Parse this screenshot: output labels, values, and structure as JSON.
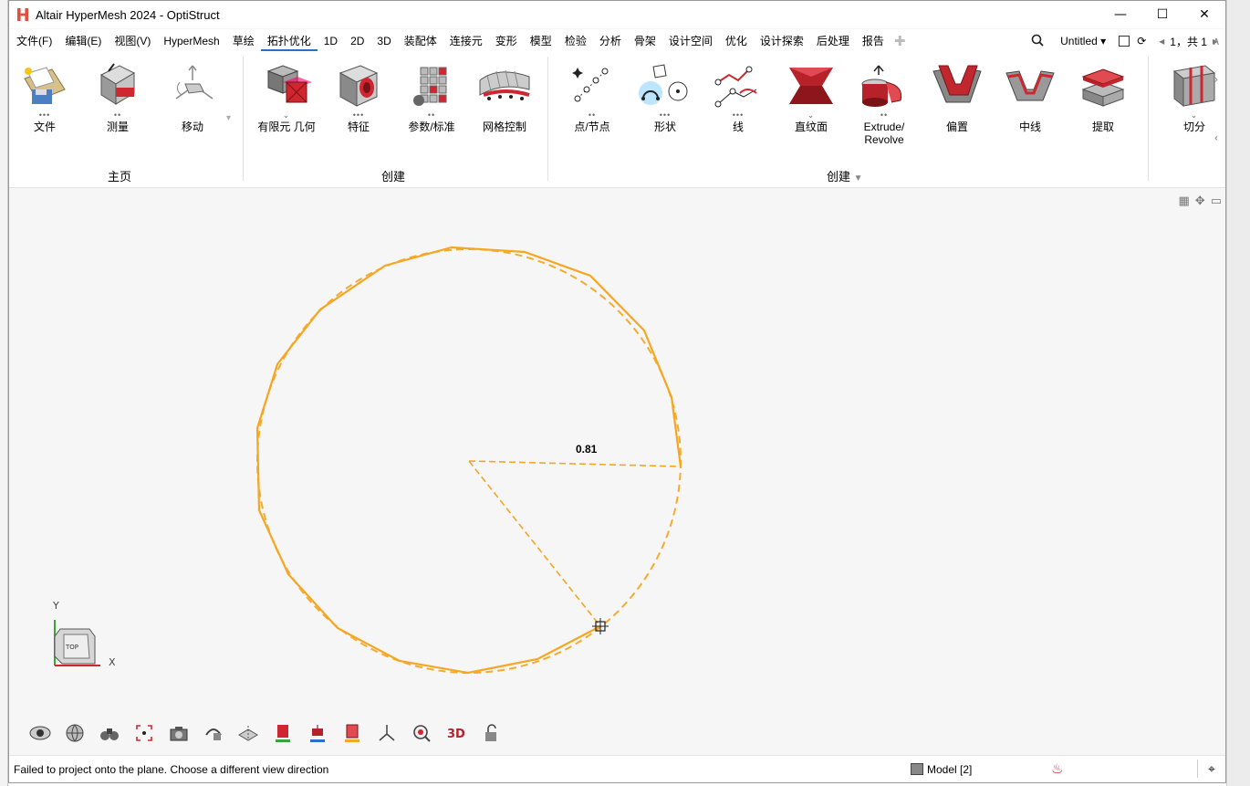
{
  "window": {
    "title": "Altair HyperMesh 2024 - OptiStruct",
    "minimize": "—",
    "maximize": "☐",
    "close": "✕"
  },
  "menu": {
    "items": [
      "文件(F)",
      "编辑(E)",
      "视图(V)",
      "HyperMesh",
      "草绘",
      "拓扑优化",
      "1D",
      "2D",
      "3D",
      "装配体",
      "连接元",
      "变形",
      "模型",
      "检验",
      "分析",
      "骨架",
      "设计空间",
      "优化",
      "设计探索",
      "后处理",
      "报告"
    ],
    "active_index": 5,
    "search_icon": "search-icon",
    "session_name": "Untitled",
    "page_indicator": "1，共 1"
  },
  "ribbon": {
    "home": {
      "group_label": "主页",
      "tools": [
        "文件",
        "测量",
        "移动"
      ]
    },
    "create1": {
      "group_label": "创建",
      "tools": [
        "有限元 几何",
        "特征",
        "参数/标准",
        "网格控制"
      ]
    },
    "create2": {
      "group_label": "创建",
      "tools": [
        "点/节点",
        "形状",
        "线",
        "直纹面",
        "Extrude/\nRevolve",
        "偏置",
        "中线",
        "提取"
      ]
    },
    "cut": {
      "tools": [
        "切分"
      ]
    }
  },
  "viewport": {
    "dimension_label": "0.81",
    "axis_y": "Y",
    "axis_x": "X",
    "viewcube_label": "TOP",
    "accent": "#f5a623"
  },
  "status": {
    "message": "Failed to project onto the plane. Choose a different view direction",
    "model_label": "Model [2]"
  }
}
